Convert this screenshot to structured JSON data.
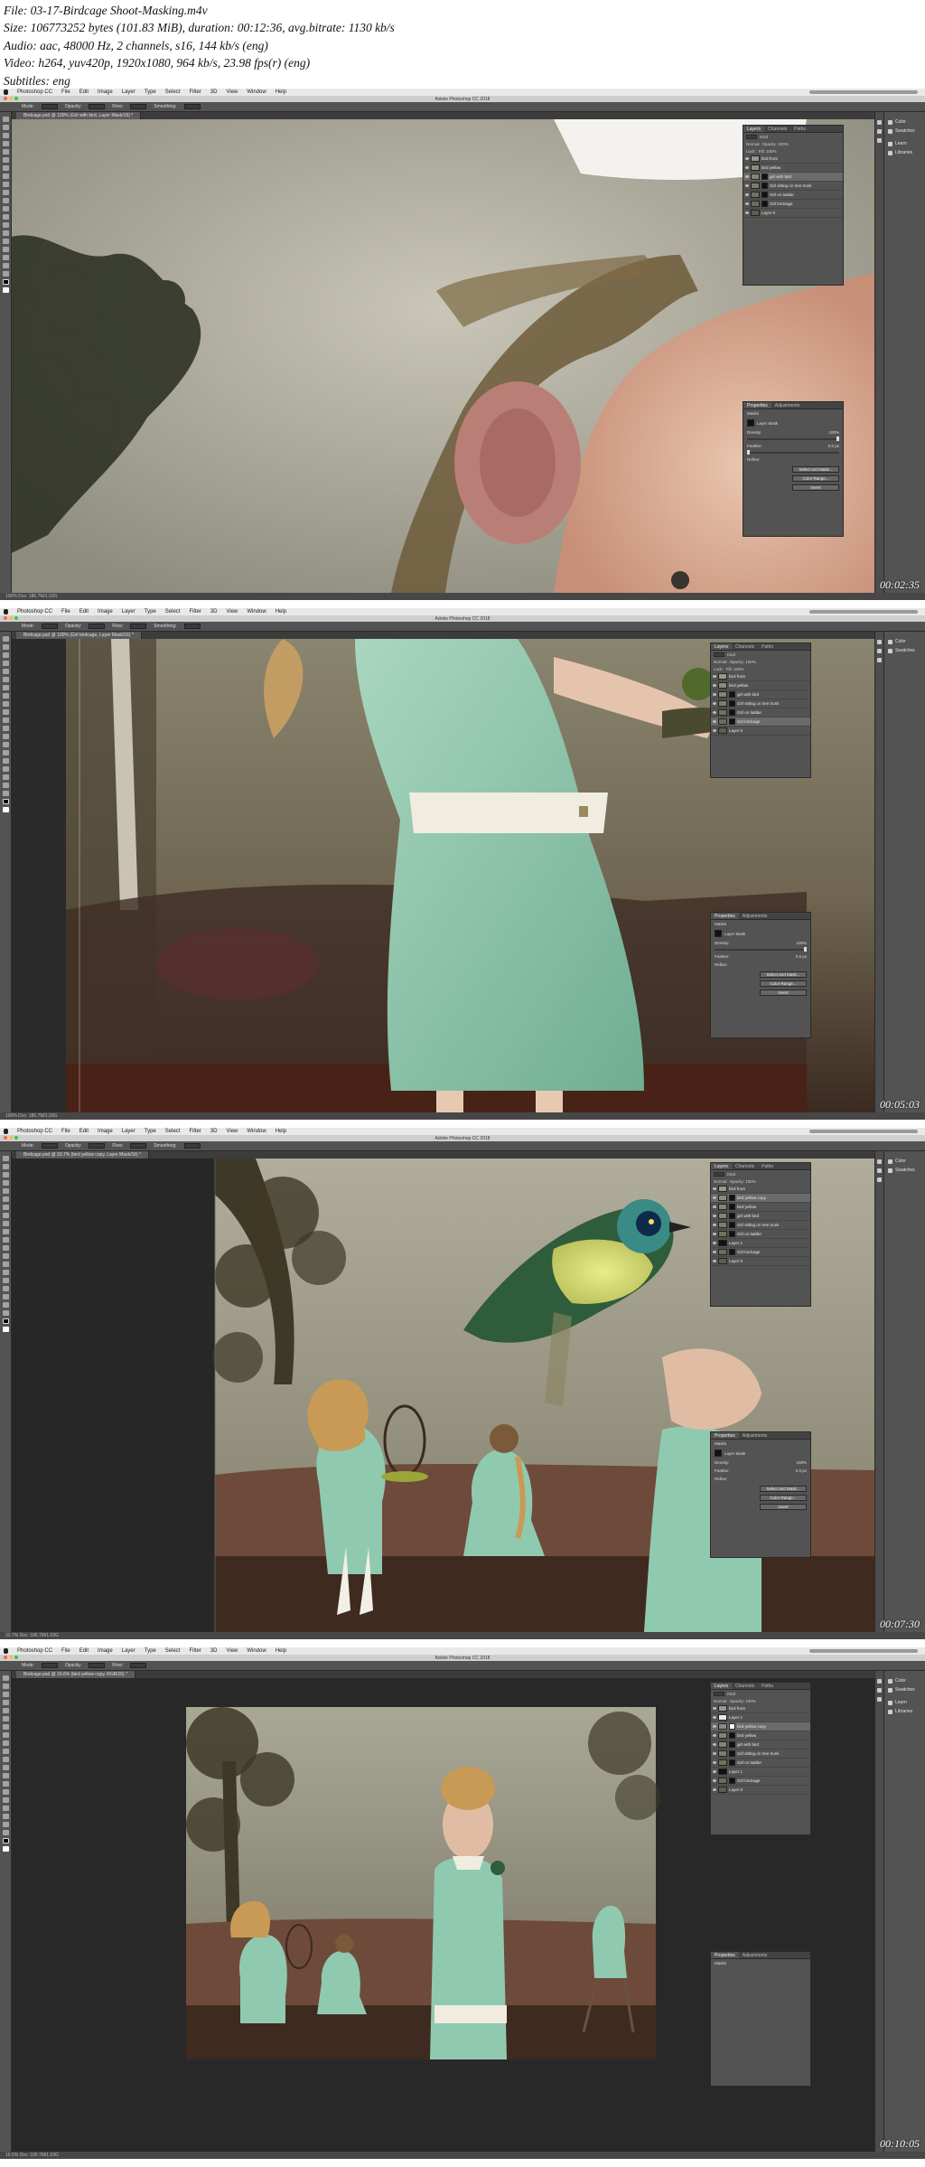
{
  "file_info": {
    "line1": "File: 03-17-Birdcage Shoot-Masking.m4v",
    "line2": "Size: 106773252 bytes (101.83 MiB), duration: 00:12:36, avg.bitrate: 1130 kb/s",
    "line3": "Audio: aac, 48000 Hz, 2 channels, s16, 144 kb/s (eng)",
    "line4": "Video: h264, yuv420p, 1920x1080, 964 kb/s, 23.98 fps(r) (eng)",
    "line5": "Subtitles: eng"
  },
  "menu": [
    "Photoshop CC",
    "File",
    "Edit",
    "Image",
    "Layer",
    "Type",
    "Select",
    "Filter",
    "3D",
    "View",
    "Window",
    "Help"
  ],
  "window_title": "Adobe Photoshop CC 2018",
  "options_bar": {
    "mode_label": "Mode:",
    "mode_value": "Normal",
    "opacity_label": "Opacity:",
    "opacity_value": "100%",
    "flow_label": "Flow:",
    "flow_value": "100%",
    "smoothing_label": "Smoothing:",
    "smoothing_value": "0%"
  },
  "right_strip": {
    "color": "Color",
    "swatches": "Swatches",
    "learn": "Learn",
    "libraries": "Libraries"
  },
  "layer_panel": {
    "tabs": [
      "Layers",
      "Channels",
      "Paths"
    ],
    "kind": "Kind",
    "mode": "Normal",
    "opacity": "Opacity: 100%",
    "lock": "Lock:",
    "fill": "Fill: 100%"
  },
  "properties_panel": {
    "tabs": [
      "Properties",
      "Adjustments"
    ],
    "masks": "Masks",
    "layer_mask": "Layer Mask",
    "density_label": "Density:",
    "density_value": "100%",
    "feather_label": "Feather:",
    "feather_value": "0.0 px",
    "refine_label": "Refine:",
    "select_mask": "Select and Mask...",
    "color_range": "Color Range...",
    "invert": "Invert"
  },
  "frames": [
    {
      "doc_tab": "Birdcage.psd @ 100% (Girl with bird, Layer Mask/16) *",
      "status": "100%   Doc: 186.7M/1.03G",
      "timestamp": "00:02:35",
      "layers": [
        "bird front",
        "bird yellow",
        "girl with bird",
        "Girl sitting on tree trunk",
        "Girl on ladder",
        "Girl birdcage",
        "Layer 0"
      ]
    },
    {
      "doc_tab": "Birdcage.psd @ 100% (Girl birdcage, Layer Mask/16) *",
      "status": "100%   Doc: 186.7M/1.03G",
      "timestamp": "00:05:03",
      "layers": [
        "bird front",
        "bird yellow",
        "girl with bird",
        "Girl sitting on tree trunk",
        "Girl on ladder",
        "Girl birdcage",
        "Layer 0"
      ]
    },
    {
      "doc_tab": "Birdcage.psd @ 33.7% (bird yellow copy, Layer Mask/16) *",
      "status": "33.7%   Doc: 186.7M/1.03G",
      "timestamp": "00:07:30",
      "layers": [
        "bird front",
        "bird yellow copy",
        "bird yellow",
        "girl with bird",
        "Girl sitting on tree trunk",
        "Girl on ladder",
        "Layer 1",
        "Girl birdcage",
        "Layer 0"
      ]
    },
    {
      "doc_tab": "Birdcage.psd @ 16.6% (bird yellow copy, RGB/16) *",
      "status": "16.6%   Doc: 186.7M/1.03G",
      "timestamp": "00:10:05",
      "layers": [
        "bird front",
        "Layer 1",
        "bird yellow copy",
        "bird yellow",
        "girl with bird",
        "Girl sitting on tree trunk",
        "Girl on ladder",
        "Layer 1",
        "Girl birdcage",
        "Layer 0"
      ]
    }
  ]
}
